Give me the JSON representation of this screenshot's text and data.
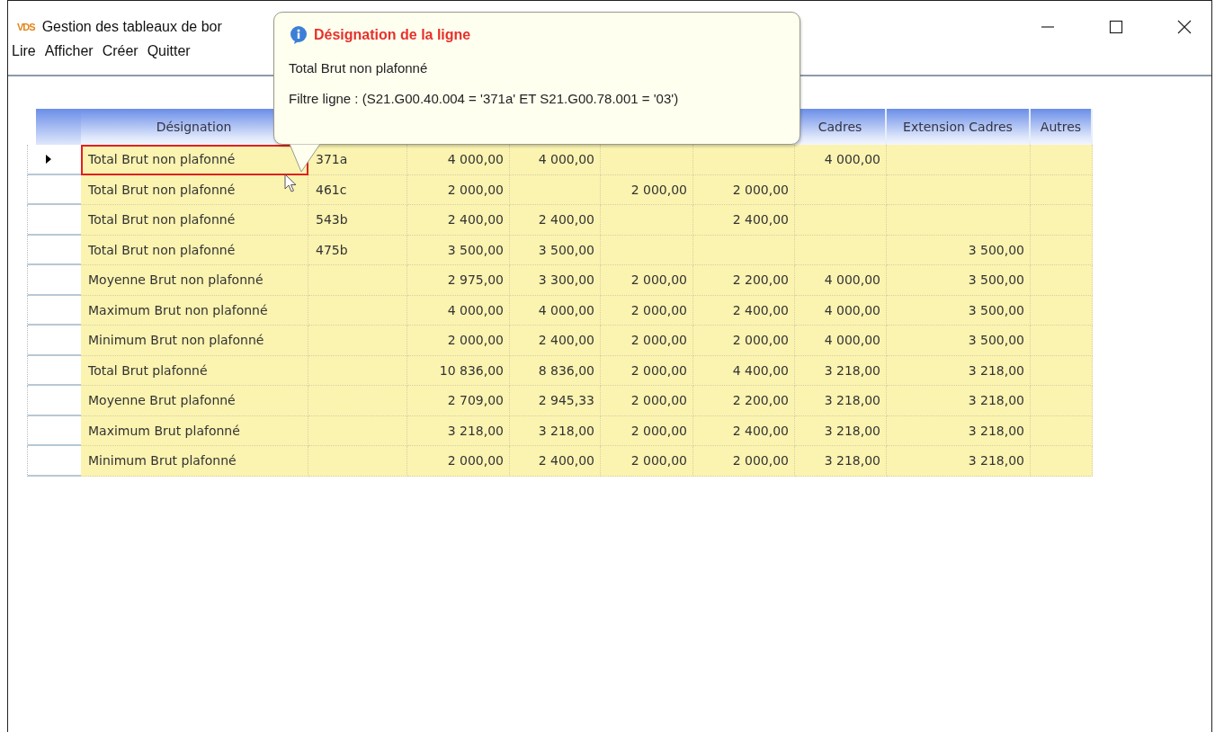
{
  "window": {
    "logo": "VDS",
    "title": "Gestion des tableaux de bor"
  },
  "menu": [
    "Lire",
    "Afficher",
    "Créer",
    "Quitter"
  ],
  "tooltip": {
    "title": "Désignation de la ligne",
    "lines": [
      "Total Brut non plafonné",
      "Filtre ligne : (S21.G00.40.004 = '371a' ET S21.G00.78.001 = '03')"
    ]
  },
  "table": {
    "columns": [
      {
        "label": "Désignation"
      },
      {},
      {},
      {},
      {},
      {},
      {
        "label": "Cadres"
      },
      {
        "label": "Extension Cadres"
      },
      {
        "label": "Autres"
      }
    ],
    "rows": [
      {
        "selected": true,
        "cells": [
          "Total Brut non plafonné",
          "371a",
          "4 000,00",
          "4 000,00",
          null,
          null,
          "4 000,00",
          null,
          null
        ]
      },
      {
        "selected": false,
        "cells": [
          "Total Brut non plafonné",
          "461c",
          "2 000,00",
          null,
          "2 000,00",
          "2 000,00",
          null,
          null,
          null
        ]
      },
      {
        "selected": false,
        "cells": [
          "Total Brut non plafonné",
          "543b",
          "2 400,00",
          "2 400,00",
          null,
          "2 400,00",
          null,
          null,
          null
        ]
      },
      {
        "selected": false,
        "cells": [
          "Total Brut non plafonné",
          "475b",
          "3 500,00",
          "3 500,00",
          null,
          null,
          null,
          "3 500,00",
          null
        ]
      },
      {
        "selected": false,
        "cells": [
          "Moyenne Brut non plafonné",
          null,
          "2 975,00",
          "3 300,00",
          "2 000,00",
          "2 200,00",
          "4 000,00",
          "3 500,00",
          null
        ]
      },
      {
        "selected": false,
        "cells": [
          "Maximum Brut non plafonné",
          null,
          "4 000,00",
          "4 000,00",
          "2 000,00",
          "2 400,00",
          "4 000,00",
          "3 500,00",
          null
        ]
      },
      {
        "selected": false,
        "cells": [
          "Minimum Brut non plafonné",
          null,
          "2 000,00",
          "2 400,00",
          "2 000,00",
          "2 000,00",
          "4 000,00",
          "3 500,00",
          null
        ]
      },
      {
        "selected": false,
        "cells": [
          "Total Brut plafonné",
          null,
          "10 836,00",
          "8 836,00",
          "2 000,00",
          "4 400,00",
          "3 218,00",
          "3 218,00",
          null
        ]
      },
      {
        "selected": false,
        "cells": [
          "Moyenne Brut plafonné",
          null,
          "2 709,00",
          "2 945,33",
          "2 000,00",
          "2 200,00",
          "3 218,00",
          "3 218,00",
          null
        ]
      },
      {
        "selected": false,
        "cells": [
          "Maximum Brut plafonné",
          null,
          "3 218,00",
          "3 218,00",
          "2 000,00",
          "2 400,00",
          "3 218,00",
          "3 218,00",
          null
        ]
      },
      {
        "selected": false,
        "cells": [
          "Minimum Brut plafonné",
          null,
          "2 000,00",
          "2 400,00",
          "2 000,00",
          "2 000,00",
          "3 218,00",
          "3 218,00",
          null
        ]
      }
    ]
  }
}
